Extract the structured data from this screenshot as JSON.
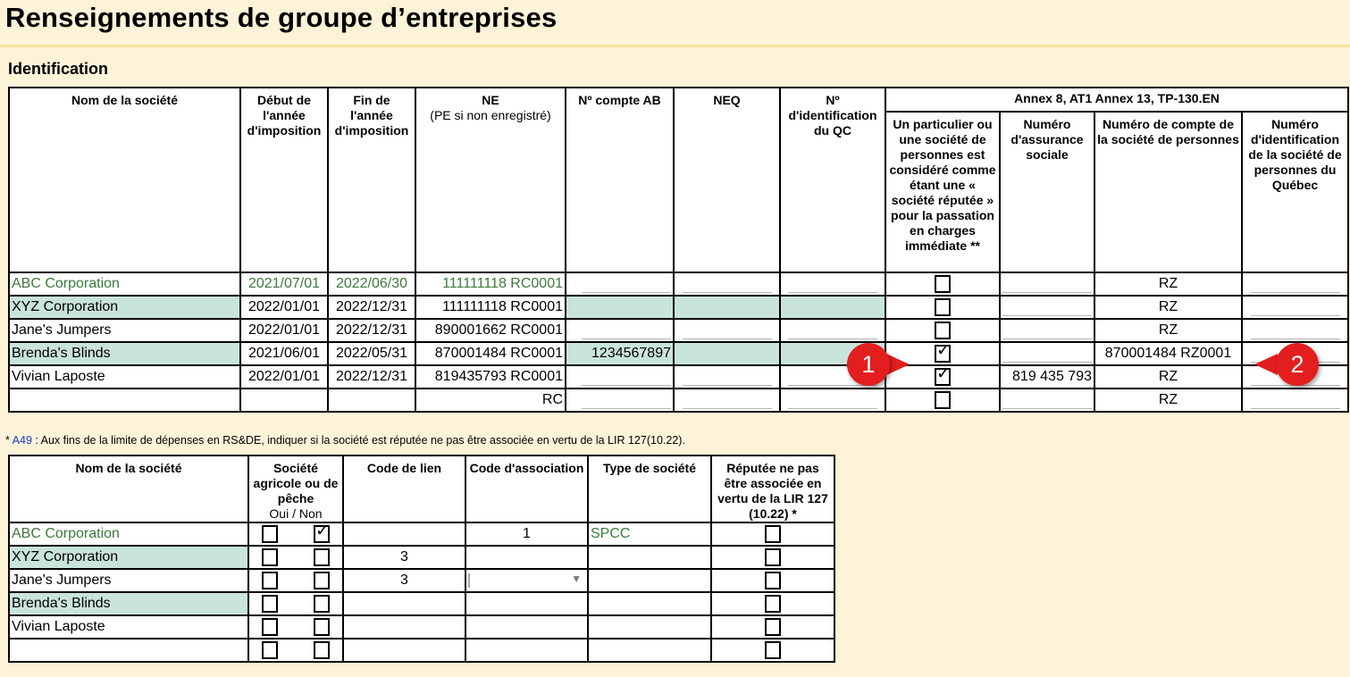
{
  "page": {
    "title": "Renseignements de groupe d’entreprises",
    "section": "Identification"
  },
  "table1": {
    "headers": {
      "name": "Nom de la société",
      "start": "Début de l'année d'imposition",
      "end": "Fin de l'année d'imposition",
      "ne": "NE",
      "ne_sub": "(PE si non enregistré)",
      "ab": "Nº compte AB",
      "neq": "NEQ",
      "qc": "Nº d'identification du QC",
      "annex": "Annex 8, AT1 Annex 13, TP-130.EN",
      "particulier": "Un particulier ou une société de personnes est considéré comme étant une « société réputée » pour la passation en charges immédiate **",
      "nas": "Numéro d'assurance sociale",
      "compte_sp": "Numéro de compte de la société de personnes",
      "id_sp_qc": "Numéro d'identification de la société de personnes du Québec"
    },
    "rows": [
      {
        "name": "ABC Corporation",
        "start": "2021/07/01",
        "end": "2022/06/30",
        "ne": "111111118 RC0001",
        "ab": "",
        "neq": "",
        "qc": "",
        "checked": false,
        "nas": "",
        "compte_sp": "RZ",
        "id_sp_qc": ""
      },
      {
        "name": "XYZ Corporation",
        "start": "2022/01/01",
        "end": "2022/12/31",
        "ne": "111111118 RC0001",
        "ab": "",
        "neq": "",
        "qc": "",
        "checked": false,
        "nas": "",
        "compte_sp": "RZ",
        "id_sp_qc": ""
      },
      {
        "name": "Jane's Jumpers",
        "start": "2022/01/01",
        "end": "2022/12/31",
        "ne": "890001662 RC0001",
        "ab": "",
        "neq": "",
        "qc": "",
        "checked": false,
        "nas": "",
        "compte_sp": "RZ",
        "id_sp_qc": ""
      },
      {
        "name": "Brenda's Blinds",
        "start": "2021/06/01",
        "end": "2022/05/31",
        "ne": "870001484 RC0001",
        "ab": "1234567897",
        "neq": "",
        "qc": "",
        "checked": true,
        "nas": "",
        "compte_sp": "870001484 RZ0001",
        "id_sp_qc": ""
      },
      {
        "name": "Vivian Laposte",
        "start": "2022/01/01",
        "end": "2022/12/31",
        "ne": "819435793 RC0001",
        "ab": "",
        "neq": "",
        "qc": "",
        "checked": true,
        "nas": "819 435 793",
        "compte_sp": "RZ",
        "id_sp_qc": ""
      },
      {
        "name": "",
        "start": "",
        "end": "",
        "ne": "RC",
        "ab": "",
        "neq": "",
        "qc": "",
        "checked": false,
        "nas": "",
        "compte_sp": "RZ",
        "id_sp_qc": ""
      }
    ]
  },
  "footnote": {
    "star": "*",
    "link": "A49",
    "text": ": Aux fins de la limite de dépenses en RS&DE, indiquer si la société est réputée ne pas être associée en vertu de la LIR 127(10.22)."
  },
  "table2": {
    "headers": {
      "name": "Nom de la société",
      "agricole": "Société agricole ou de pêche",
      "agricole_sub": "Oui / Non",
      "lien": "Code de lien",
      "association": "Code d'association",
      "type": "Type de société",
      "reputee": "Réputée ne pas être associée en vertu de la LIR 127 (10.22) *"
    },
    "rows": [
      {
        "name": "ABC Corporation",
        "oui": false,
        "non": true,
        "lien": "",
        "association": "1",
        "type": "SPCC",
        "reputee": false
      },
      {
        "name": "XYZ Corporation",
        "oui": false,
        "non": false,
        "lien": "3",
        "association": "",
        "type": "",
        "reputee": false
      },
      {
        "name": "Jane's Jumpers",
        "oui": false,
        "non": false,
        "lien": "3",
        "association": "",
        "type": "",
        "reputee": false
      },
      {
        "name": "Brenda's Blinds",
        "oui": false,
        "non": false,
        "lien": "",
        "association": "",
        "type": "",
        "reputee": false
      },
      {
        "name": "Vivian Laposte",
        "oui": false,
        "non": false,
        "lien": "",
        "association": "",
        "type": "",
        "reputee": false
      },
      {
        "name": "",
        "oui": false,
        "non": false,
        "lien": "",
        "association": "",
        "type": "",
        "reputee": false
      }
    ]
  },
  "callouts": [
    "1",
    "2"
  ],
  "colors": {
    "shade": "#c9e4dc",
    "green_text": "#3b7a3b",
    "callout": "#e31e1e",
    "background": "#fdf3d8"
  }
}
